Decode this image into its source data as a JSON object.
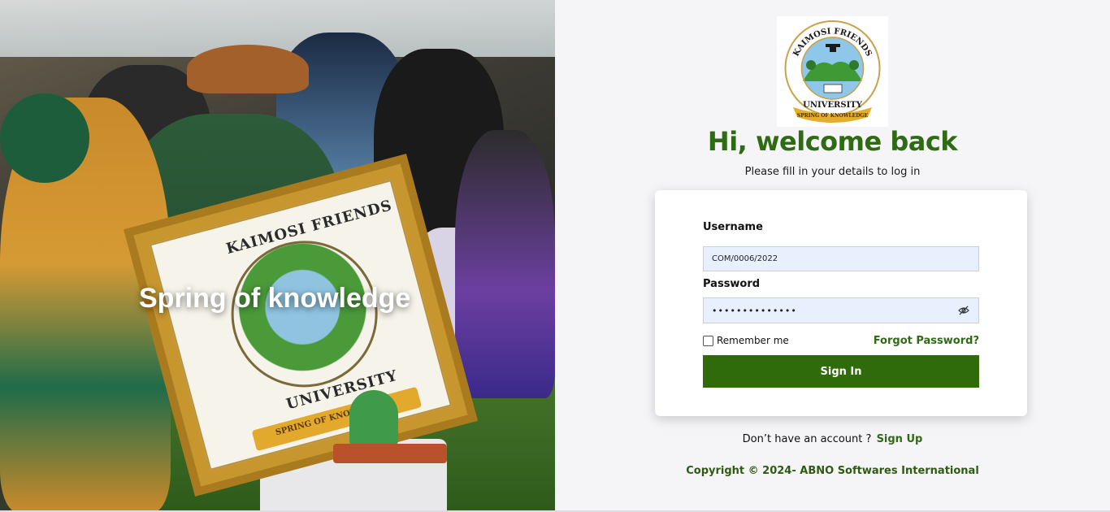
{
  "hero": {
    "tagline": "Spring of knowledge",
    "frame_text_top": "KAIMOSI FRIENDS",
    "frame_text_bottom": "UNIVERSITY",
    "frame_ribbon": "SPRING OF KNOWLEDGE"
  },
  "logo": {
    "text_top": "KAIMOSI FRIENDS",
    "text_bottom": "UNIVERSITY",
    "ribbon": "SPRING OF KNOWLEDGE"
  },
  "header": {
    "title": "Hi, welcome back",
    "subtitle": "Please fill in your details to log in"
  },
  "form": {
    "username_label": "Username",
    "username_value": "COM/0006/2022",
    "password_label": "Password",
    "password_value": "••••••••••••••",
    "remember_label": "Remember me",
    "remember_checked": false,
    "forgot_label": "Forgot Password?",
    "signin_label": "Sign In",
    "password_toggle_icon": "eye-slash-icon"
  },
  "footer": {
    "signup_prompt": "Don’t have an account ?",
    "signup_link": "Sign Up",
    "copyright": "Copyright © 2024- ABNO Softwares International"
  },
  "colors": {
    "brand_green": "#2f6b14",
    "button_green": "#2f6b0a",
    "input_bg": "#e8f0fe"
  }
}
